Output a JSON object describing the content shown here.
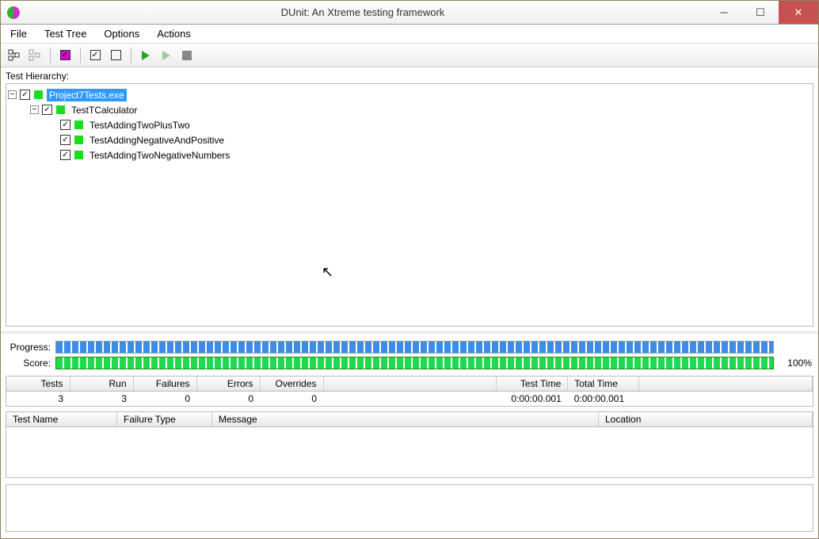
{
  "window": {
    "title": "DUnit: An Xtreme testing framework"
  },
  "menu": {
    "file": "File",
    "testtree": "Test Tree",
    "options": "Options",
    "actions": "Actions"
  },
  "labels": {
    "hierarchy": "Test Hierarchy:",
    "progress": "Progress:",
    "score": "Score:",
    "score_pct": "100%"
  },
  "tree": {
    "root": {
      "label": "Project7Tests.exe",
      "expanded": true,
      "checked": true,
      "status": "pass",
      "selected": true
    },
    "suite": {
      "label": "TestTCalculator",
      "expanded": true,
      "checked": true,
      "status": "pass"
    },
    "tests": [
      {
        "label": "TestAddingTwoPlusTwo",
        "checked": true,
        "status": "pass"
      },
      {
        "label": "TestAddingNegativeAndPositive",
        "checked": true,
        "status": "pass"
      },
      {
        "label": "TestAddingTwoNegativeNumbers",
        "checked": true,
        "status": "pass"
      }
    ]
  },
  "stats": {
    "headers": {
      "tests": "Tests",
      "run": "Run",
      "failures": "Failures",
      "errors": "Errors",
      "overrides": "Overrides",
      "testtime": "Test Time",
      "totaltime": "Total Time"
    },
    "values": {
      "tests": "3",
      "run": "3",
      "failures": "0",
      "errors": "0",
      "overrides": "0",
      "testtime": "0:00:00.001",
      "totaltime": "0:00:00.001"
    }
  },
  "results": {
    "headers": {
      "testname": "Test Name",
      "ftype": "Failure Type",
      "message": "Message",
      "location": "Location"
    }
  },
  "icons": {
    "select_all": "select-all-icon",
    "deselect_all": "deselect-all-icon"
  }
}
